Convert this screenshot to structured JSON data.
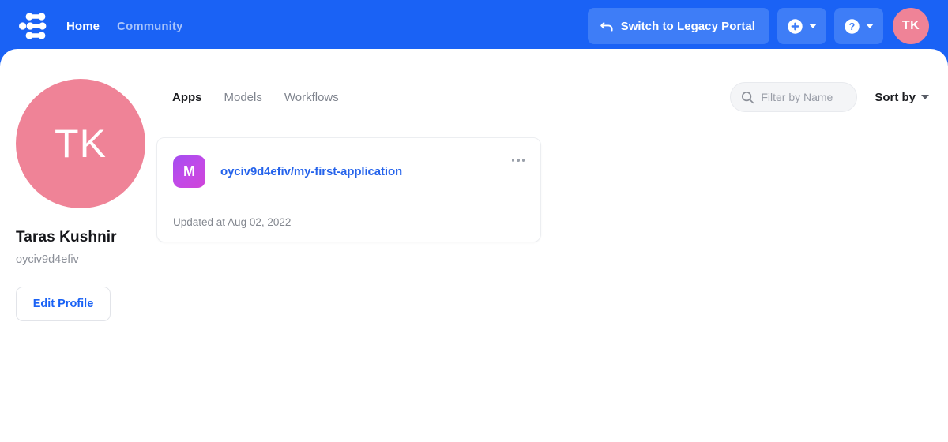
{
  "header": {
    "logo_icon": "clarifai-logo-icon",
    "nav": [
      {
        "label": "Home",
        "state": "active"
      },
      {
        "label": "Community",
        "state": "inactive"
      }
    ],
    "legacy_button": {
      "label": "Switch to Legacy Portal",
      "icon": "undo-arrow-icon"
    },
    "create_button": {
      "icon": "plus-circle-icon",
      "caret": "chevron-down-icon"
    },
    "help_button": {
      "icon": "question-circle-icon",
      "caret": "chevron-down-icon"
    },
    "avatar": {
      "initials": "TK"
    },
    "colors": {
      "bar_background": "#1a62f5",
      "button_background": "#3e7df7",
      "avatar_background": "#ef8397"
    }
  },
  "profile": {
    "avatar_initials": "TK",
    "name": "Taras Kushnir",
    "handle": "oyciv9d4efiv",
    "edit_button_label": "Edit Profile",
    "avatar_color": "#ef8397",
    "edit_button_text_color": "#1a62f5"
  },
  "main": {
    "tabs": [
      {
        "label": "Apps",
        "state": "active"
      },
      {
        "label": "Models",
        "state": "inactive"
      },
      {
        "label": "Workflows",
        "state": "inactive"
      }
    ],
    "search": {
      "placeholder": "Filter by Name",
      "value": "",
      "icon": "search-icon"
    },
    "sort": {
      "label": "Sort by",
      "caret": "chevron-down-icon"
    },
    "cards": [
      {
        "icon_letter": "M",
        "icon_gradient_from": "#a34df0",
        "icon_gradient_to": "#cf44d8",
        "title": "oyciv9d4efiv/my-first-application",
        "title_color": "#2563eb",
        "menu_icon": "ellipsis-horizontal-icon",
        "updated_text": "Updated at Aug 02, 2022"
      }
    ]
  }
}
